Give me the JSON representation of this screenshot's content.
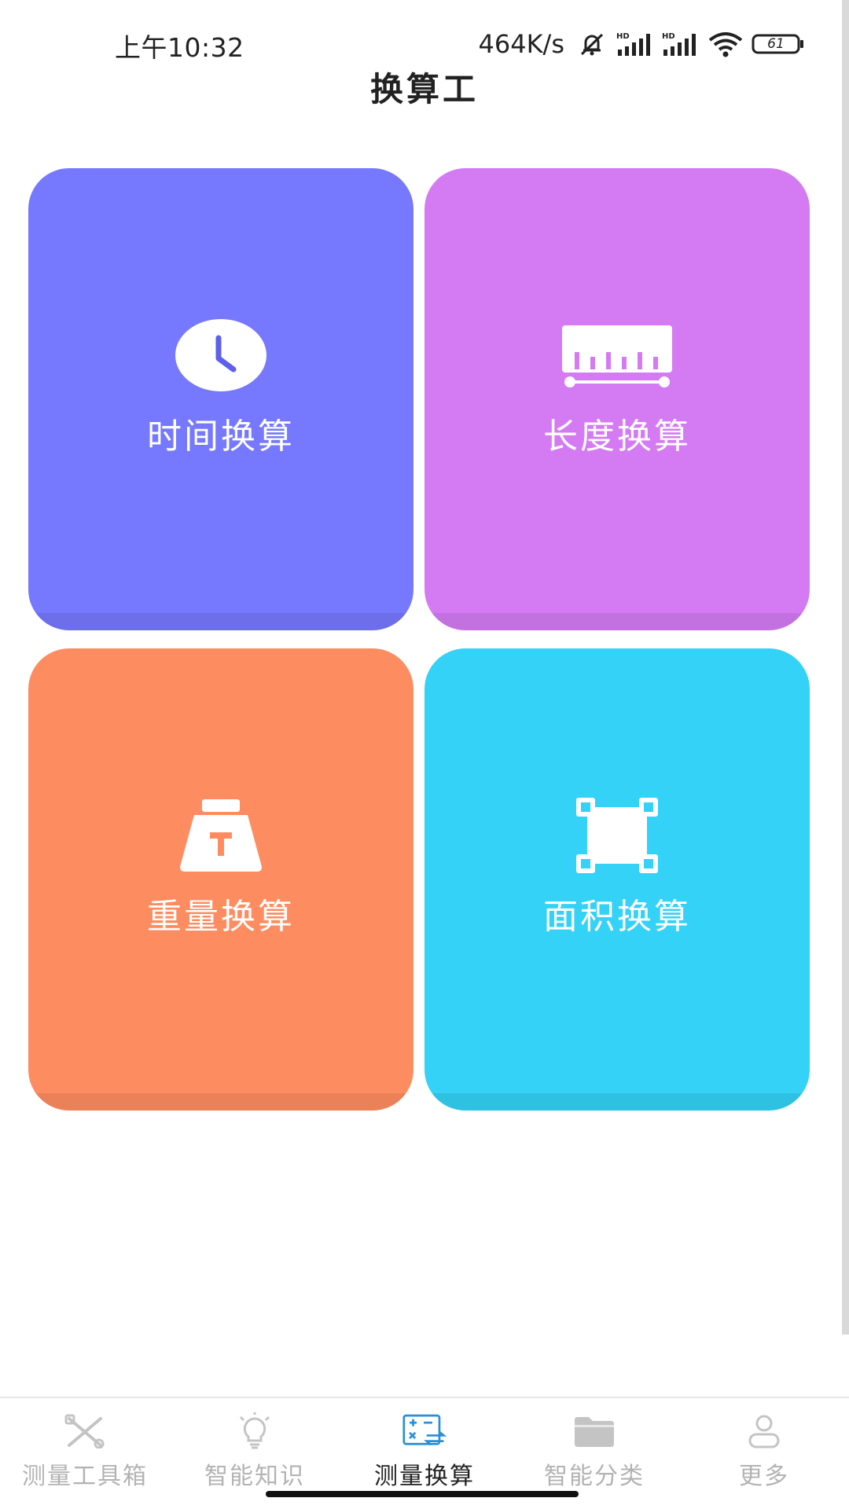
{
  "status_bar": {
    "time": "上午10:32",
    "net_speed": "464K/s",
    "battery_level": "61",
    "icons": [
      "mute-bell-icon",
      "hd-signal-icon",
      "hd-signal-icon",
      "wifi-icon",
      "battery-icon"
    ]
  },
  "header": {
    "title": "换算工"
  },
  "cards": [
    {
      "label": "时间换算",
      "icon": "clock-icon",
      "color": "#7679fd"
    },
    {
      "label": "长度换算",
      "icon": "ruler-icon",
      "color": "#d47bf4"
    },
    {
      "label": "重量换算",
      "icon": "weight-icon",
      "color": "#fe8c61"
    },
    {
      "label": "面积换算",
      "icon": "area-icon",
      "color": "#33d2f6"
    }
  ],
  "bottom_nav": {
    "items": [
      {
        "label": "测量工具箱",
        "icon": "tools-icon",
        "active": false
      },
      {
        "label": "智能知识",
        "icon": "lightbulb-icon",
        "active": false
      },
      {
        "label": "测量换算",
        "icon": "calculator-icon",
        "active": true
      },
      {
        "label": "智能分类",
        "icon": "folder-icon",
        "active": false
      },
      {
        "label": "更多",
        "icon": "user-icon",
        "active": false
      }
    ],
    "active_color": "#222222",
    "inactive_color": "#b3b3b3",
    "accent_color": "#2a8fd6"
  }
}
